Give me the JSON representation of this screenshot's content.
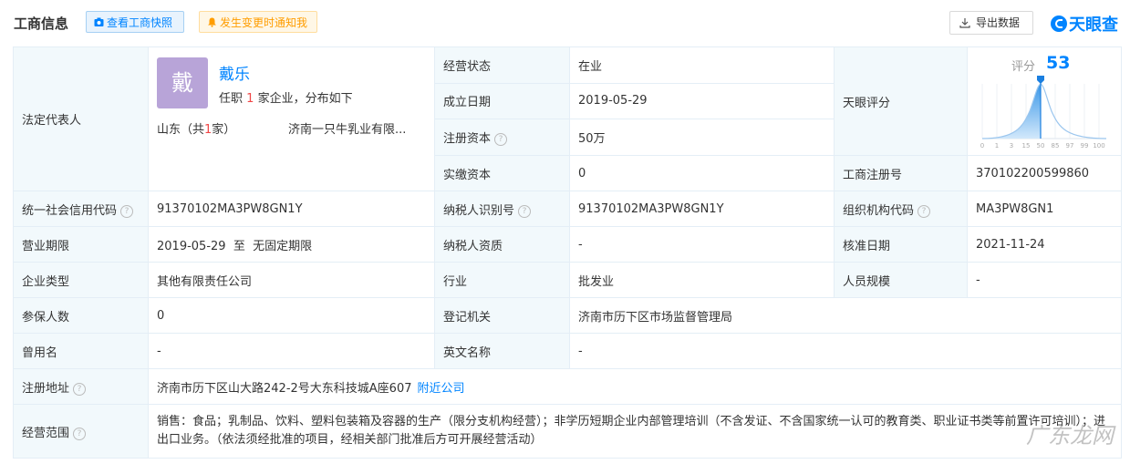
{
  "header": {
    "title": "工商信息",
    "snapshot_label": "查看工商快照",
    "notify_label": "发生变更时通知我",
    "export_label": "导出数据",
    "brand": "天眼查"
  },
  "rep": {
    "label": "法定代表人",
    "avatar_char": "戴",
    "name": "戴乐",
    "sub_prefix": "任职",
    "sub_count": "1",
    "sub_suffix": "家企业，分布如下",
    "prov_prefix": "山东（共",
    "prov_count": "1",
    "prov_suffix": "家）",
    "company": "济南一只牛乳业有限..."
  },
  "fields": {
    "status_label": "经营状态",
    "status": "在业",
    "founded_label": "成立日期",
    "founded": "2019-05-29",
    "reg_capital_label": "注册资本",
    "reg_capital": "50万",
    "paid_capital_label": "实缴资本",
    "paid_capital": "0",
    "score_title": "天眼评分",
    "score_label": "评分",
    "score": "53",
    "reg_no_label": "工商注册号",
    "reg_no": "370102200599860",
    "credit_label": "统一社会信用代码",
    "credit": "91370102MA3PW8GN1Y",
    "taxid_label": "纳税人识别号",
    "taxid": "91370102MA3PW8GN1Y",
    "org_label": "组织机构代码",
    "org": "MA3PW8GN1",
    "term_label": "营业期限",
    "term": "2019-05-29  至  无固定期限",
    "tax_qual_label": "纳税人资质",
    "tax_qual": "-",
    "approve_label": "核准日期",
    "approve": "2021-11-24",
    "type_label": "企业类型",
    "type": "其他有限责任公司",
    "industry_label": "行业",
    "industry": "批发业",
    "staff_label": "人员规模",
    "staff": "-",
    "insured_label": "参保人数",
    "insured": "0",
    "authority_label": "登记机关",
    "authority": "济南市历下区市场监督管理局",
    "former_label": "曾用名",
    "former": "-",
    "english_label": "英文名称",
    "english": "-",
    "address_label": "注册地址",
    "address": "济南市历下区山大路242-2号大东科技城A座607",
    "nearby_label": "附近公司",
    "scope_label": "经营范围",
    "scope": "销售：食品；乳制品、饮料、塑料包装箱及容器的生产（限分支机构经营）；非学历短期企业内部管理培训（不含发证、不含国家统一认可的教育类、职业证书类等前置许可培训）；进出口业务。（依法须经批准的项目，经相关部门批准后方可开展经营活动）"
  },
  "score_axis": [
    "0",
    "1",
    "3",
    "15",
    "50",
    "85",
    "97",
    "99",
    "100"
  ],
  "watermark": "广东龙网"
}
